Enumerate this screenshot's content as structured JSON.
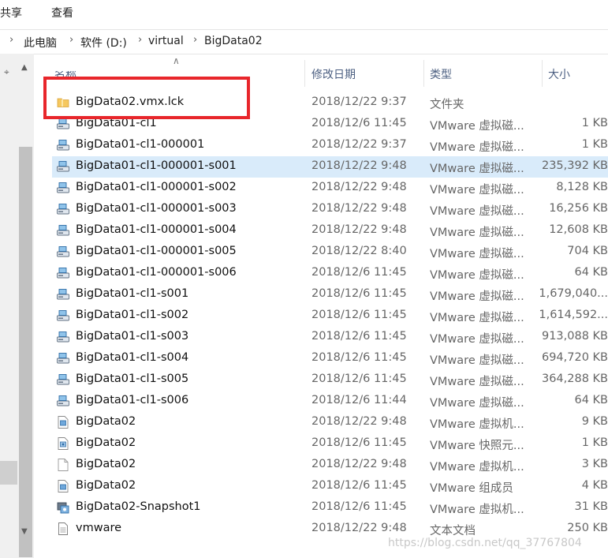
{
  "ribbon": {
    "tabs": [
      "共享",
      "查看"
    ]
  },
  "address_bar": {
    "crumbs": [
      "此电脑",
      "软件 (D:)",
      "virtual",
      "BigData02"
    ]
  },
  "columns": {
    "name": "名称",
    "date": "修改日期",
    "type": "类型",
    "size": "大小"
  },
  "files": [
    {
      "name": "BigData02.vmx.lck",
      "date": "2018/12/22 9:37",
      "type": "文件夹",
      "size": "",
      "icon": "folder-icon"
    },
    {
      "name": "BigData01-cl1",
      "date": "2018/12/6 11:45",
      "type": "VMware 虚拟磁...",
      "size": "1 KB",
      "icon": "vmdk-icon"
    },
    {
      "name": "BigData01-cl1-000001",
      "date": "2018/12/22 9:37",
      "type": "VMware 虚拟磁...",
      "size": "1 KB",
      "icon": "vmdk-icon"
    },
    {
      "name": "BigData01-cl1-000001-s001",
      "date": "2018/12/22 9:48",
      "type": "VMware 虚拟磁...",
      "size": "235,392 KB",
      "icon": "vmdk-icon",
      "selected": true
    },
    {
      "name": "BigData01-cl1-000001-s002",
      "date": "2018/12/22 9:48",
      "type": "VMware 虚拟磁...",
      "size": "8,128 KB",
      "icon": "vmdk-icon"
    },
    {
      "name": "BigData01-cl1-000001-s003",
      "date": "2018/12/22 9:48",
      "type": "VMware 虚拟磁...",
      "size": "16,256 KB",
      "icon": "vmdk-icon"
    },
    {
      "name": "BigData01-cl1-000001-s004",
      "date": "2018/12/22 9:48",
      "type": "VMware 虚拟磁...",
      "size": "12,608 KB",
      "icon": "vmdk-icon"
    },
    {
      "name": "BigData01-cl1-000001-s005",
      "date": "2018/12/22 8:40",
      "type": "VMware 虚拟磁...",
      "size": "704 KB",
      "icon": "vmdk-icon"
    },
    {
      "name": "BigData01-cl1-000001-s006",
      "date": "2018/12/6 11:45",
      "type": "VMware 虚拟磁...",
      "size": "64 KB",
      "icon": "vmdk-icon"
    },
    {
      "name": "BigData01-cl1-s001",
      "date": "2018/12/6 11:45",
      "type": "VMware 虚拟磁...",
      "size": "1,679,040...",
      "icon": "vmdk-icon"
    },
    {
      "name": "BigData01-cl1-s002",
      "date": "2018/12/6 11:45",
      "type": "VMware 虚拟磁...",
      "size": "1,614,592...",
      "icon": "vmdk-icon"
    },
    {
      "name": "BigData01-cl1-s003",
      "date": "2018/12/6 11:45",
      "type": "VMware 虚拟磁...",
      "size": "913,088 KB",
      "icon": "vmdk-icon"
    },
    {
      "name": "BigData01-cl1-s004",
      "date": "2018/12/6 11:45",
      "type": "VMware 虚拟磁...",
      "size": "694,720 KB",
      "icon": "vmdk-icon"
    },
    {
      "name": "BigData01-cl1-s005",
      "date": "2018/12/6 11:45",
      "type": "VMware 虚拟磁...",
      "size": "364,288 KB",
      "icon": "vmdk-icon"
    },
    {
      "name": "BigData01-cl1-s006",
      "date": "2018/12/6 11:44",
      "type": "VMware 虚拟磁...",
      "size": "64 KB",
      "icon": "vmdk-icon"
    },
    {
      "name": "BigData02",
      "date": "2018/12/22 9:48",
      "type": "VMware 虚拟机...",
      "size": "9 KB",
      "icon": "vmx-icon"
    },
    {
      "name": "BigData02",
      "date": "2018/12/6 11:45",
      "type": "VMware 快照元...",
      "size": "1 KB",
      "icon": "vmsd-icon"
    },
    {
      "name": "BigData02",
      "date": "2018/12/22 9:48",
      "type": "VMware 虚拟机...",
      "size": "3 KB",
      "icon": "vmxf-icon"
    },
    {
      "name": "BigData02",
      "date": "2018/12/6 11:45",
      "type": "VMware 组成员",
      "size": "4 KB",
      "icon": "vmx-icon"
    },
    {
      "name": "BigData02-Snapshot1",
      "date": "2018/12/6 11:45",
      "type": "VMware 虚拟机...",
      "size": "31 KB",
      "icon": "snapshot-icon"
    },
    {
      "name": "vmware",
      "date": "2018/12/22 9:48",
      "type": "文本文档",
      "size": "250 KB",
      "icon": "text-file-icon"
    }
  ],
  "watermark": "https://blog.csdn.net/qq_37767804",
  "colors": {
    "selected_row": "#d9ebfa",
    "highlight_box": "#e8262b",
    "header_text": "#4d6082"
  }
}
